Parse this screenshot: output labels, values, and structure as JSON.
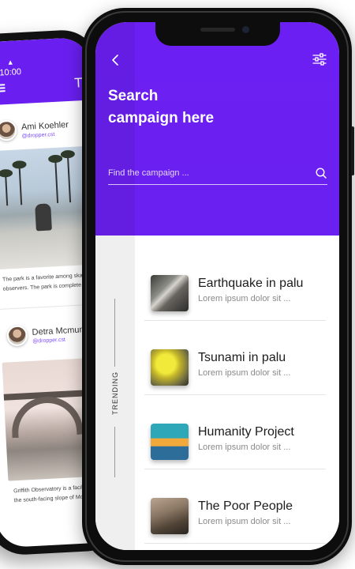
{
  "back_phone": {
    "time": "10:00",
    "header_title_fragment": "Tr",
    "posts": [
      {
        "author": "Ami Koehler",
        "handle": "@dropper.cst",
        "caption_lines": [
          "The park is a favorite among skat",
          "observers. The park is complete..."
        ]
      },
      {
        "author": "Detra Mcmunn",
        "handle": "@dropper.cst",
        "caption_lines": [
          "Griffith Observatory is a facility in",
          "the south-facing slope of Mou"
        ]
      }
    ]
  },
  "header": {
    "title_line1": "Search",
    "title_line2": "campaign here",
    "accent_color": "#6a1ff0"
  },
  "search": {
    "placeholder": "Find the campaign ...",
    "value": ""
  },
  "rail": {
    "label": "TRENDING"
  },
  "campaigns": [
    {
      "title": "Earthquake in palu",
      "subtitle": "Lorem ipsum dolor sit ..."
    },
    {
      "title": "Tsunami in palu",
      "subtitle": "Lorem ipsum dolor sit ..."
    },
    {
      "title": "Humanity Project",
      "subtitle": "Lorem ipsum dolor sit ..."
    },
    {
      "title": "The Poor People",
      "subtitle": "Lorem ipsum dolor sit ..."
    }
  ]
}
